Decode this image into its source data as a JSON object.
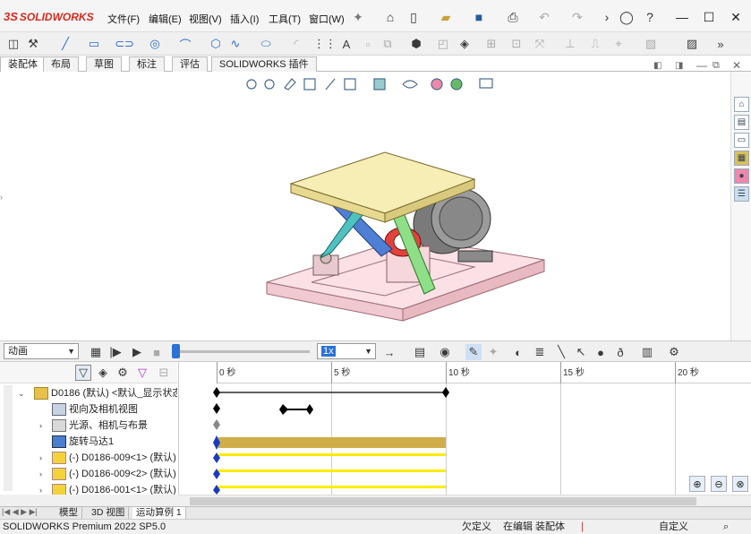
{
  "app": {
    "brand": "SOLIDWORKS",
    "brand_prefix": "3S"
  },
  "menu": [
    "文件(F)",
    "编辑(E)",
    "视图(V)",
    "插入(I)",
    "工具(T)",
    "窗口(W)"
  ],
  "tabs": [
    "装配体",
    "布局",
    "草图",
    "标注",
    "评估",
    "SOLIDWORKS 插件"
  ],
  "active_tab": 0,
  "motion": {
    "study_type": "动画",
    "playback_speed": "1x",
    "ruler_labels": [
      "0 秒",
      "5 秒",
      "10 秒",
      "15 秒",
      "20 秒"
    ]
  },
  "tree": {
    "rows": [
      {
        "label": "D0186 (默认) <默认_显示状态",
        "icon": "assembly-icon"
      },
      {
        "label": "视向及相机视图",
        "icon": "camera-icon"
      },
      {
        "label": "光源、相机与布景",
        "icon": "light-icon"
      },
      {
        "label": "旋转马达1",
        "icon": "motor-icon"
      },
      {
        "label": "(-) D0186-009<1> (默认)",
        "icon": "part-icon"
      },
      {
        "label": "(-) D0186-009<2> (默认)",
        "icon": "part-icon"
      },
      {
        "label": "(-) D0186-001<1> (默认)",
        "icon": "part-icon"
      }
    ]
  },
  "bottom_tabs": [
    "模型",
    "3D 视图",
    "运动算例 1"
  ],
  "status": {
    "product": "SOLIDWORKS Premium 2022 SP5.0",
    "defined": "欠定义",
    "editing": "在编辑 装配体",
    "custom": "自定义"
  },
  "colors": {
    "accent": "#d62a1e",
    "timeline_bar": "#cfae4a",
    "key_yellow": "#ffeb00"
  }
}
